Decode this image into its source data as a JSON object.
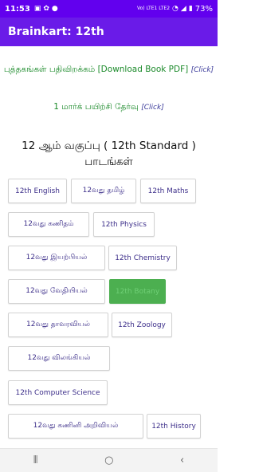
{
  "status_bar": {
    "time": "11:53",
    "network": "Vo) LTE1\nLTE2",
    "battery_pct": "73%"
  },
  "app_bar": {
    "title": "Brainkart: 12th"
  },
  "download_link": {
    "text": "புத்தகங்கள் பதிவிறக்கம் [Download Book PDF]",
    "click": "[Click]"
  },
  "test_link": {
    "text": "1 மார்க் பயிற்சி தேர்வு",
    "click": "[Click]"
  },
  "heading": "12 ஆம் வகுப்பு ( 12th Standard ) பாடங்கள்",
  "subjects": [
    "12th English",
    "12வது தமிழ்",
    "12th Maths",
    "12வது கணிதம்",
    "12th Physics",
    "12வது இயற்பியல்",
    "12th Chemistry",
    "12வது வேதியியல்",
    "12th Botany",
    "12வது தாவரவியல்",
    "12th Zoology",
    "12வது விலங்கியல்",
    "12th Computer Science",
    "12வது கணினி அறிவியல்",
    "12th History"
  ],
  "colors": {
    "app_bar": "#6a1be8",
    "link_green": "#1b8a2a",
    "button_text": "#3d2f8a",
    "active_button": "#4caf50"
  },
  "icons": [
    "battery-icon",
    "signal-icon",
    "wifi-icon",
    "settings-icon",
    "recents-icon",
    "home-icon",
    "back-icon"
  ]
}
